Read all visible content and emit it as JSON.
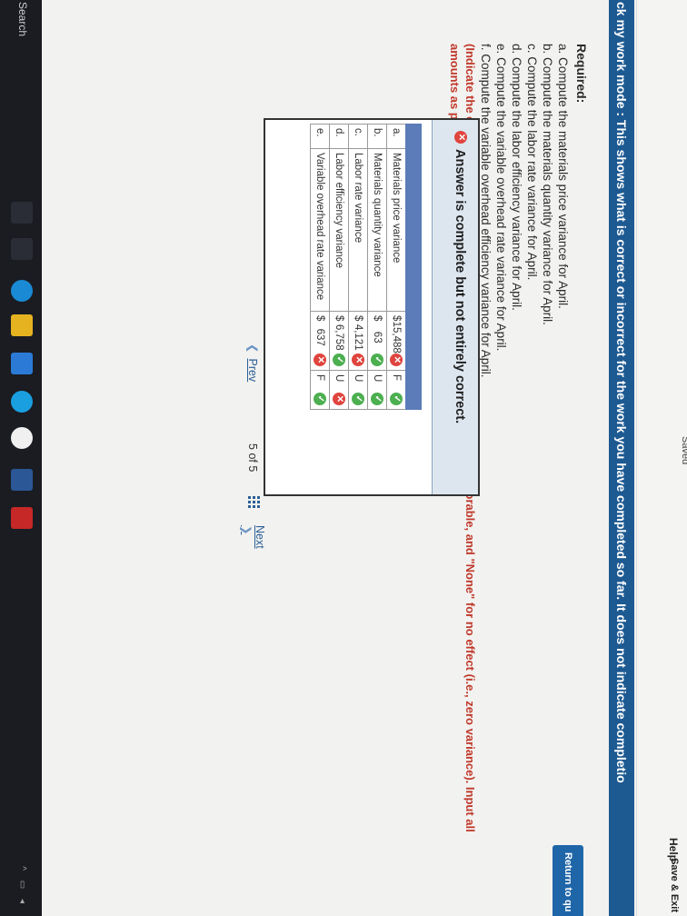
{
  "header": {
    "saved_label": "Saved",
    "help_label": "Help",
    "save_exit_label": "Save & Exit",
    "banner_text": "ck my work mode : This shows what is correct or incorrect for the work you have completed so far. It does not indicate completio",
    "return_label": "Return to qu"
  },
  "required": {
    "title": "Required:",
    "items": [
      "a. Compute the materials price variance for April.",
      "b. Compute the materials quantity variance for April.",
      "c. Compute the labor rate variance for April.",
      "d. Compute the labor efficiency variance for April.",
      "e. Compute the variable overhead rate variance for April.",
      "f. Compute the variable overhead efficiency variance for April."
    ],
    "instruction": "(Indicate the effect of each variance by selecting \"F\" for favorable, \"U\" for unfavorable, and \"None\" for no effect (i.e., zero variance). Input all amounts as positive values.)"
  },
  "answer": {
    "status": "Answer is complete but not entirely correct.",
    "rows": [
      {
        "key": "a.",
        "label": "Materials price variance",
        "currency": "$",
        "amount": "15,488",
        "amount_status": "bad",
        "effect": "F",
        "effect_status": "ok"
      },
      {
        "key": "b.",
        "label": "Materials quantity variance",
        "currency": "$",
        "amount": "63",
        "amount_status": "ok",
        "effect": "U",
        "effect_status": "ok"
      },
      {
        "key": "c.",
        "label": "Labor rate variance",
        "currency": "$",
        "amount": "4,121",
        "amount_status": "bad",
        "effect": "U",
        "effect_status": "ok"
      },
      {
        "key": "d.",
        "label": "Labor efficiency variance",
        "currency": "$",
        "amount": "6,758",
        "amount_status": "ok",
        "effect": "U",
        "effect_status": "bad"
      },
      {
        "key": "e.",
        "label": "Variable overhead rate variance",
        "currency": "$",
        "amount": "637",
        "amount_status": "bad",
        "effect": "F",
        "effect_status": "ok"
      }
    ]
  },
  "pagination": {
    "prev_label": "Prev",
    "current": "5",
    "of_label": "of",
    "total": "5",
    "next_label": "Next"
  },
  "taskbar": {
    "search_label": "Search"
  },
  "colors": {
    "banner": "#1e5a92",
    "correct": "#4caf50",
    "incorrect": "#e0443e",
    "table_header": "#5b7cb8"
  }
}
